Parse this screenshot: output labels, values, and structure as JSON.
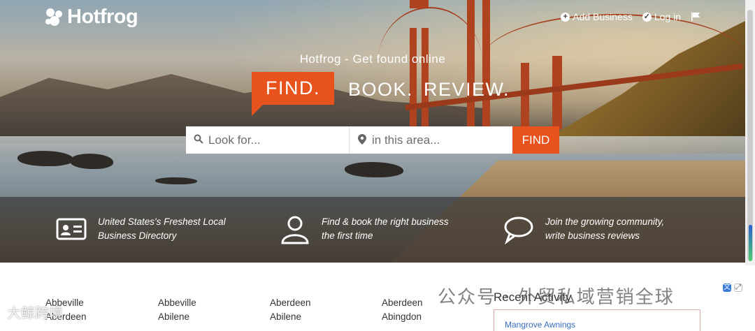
{
  "brand": {
    "name": "Hotfrog"
  },
  "nav": {
    "add_business": "Add Business",
    "login": "Log in"
  },
  "hero": {
    "tagline": "Hotfrog - Get found online",
    "headline_find": "FIND.",
    "headline_rest": "BOOK. REVIEW."
  },
  "search": {
    "what_placeholder": "Look for...",
    "where_placeholder": "in this area...",
    "button": "FIND"
  },
  "features": [
    {
      "icon": "id-card-icon",
      "text": "United States's Freshest Local Business Directory"
    },
    {
      "icon": "user-icon",
      "text": "Find & book the right business the first time"
    },
    {
      "icon": "chat-bubble-icon",
      "text": "Join the growing community, write business reviews"
    }
  ],
  "directory": {
    "columns": [
      [
        "Abbeville",
        "Aberdeen"
      ],
      [
        "Abbeville",
        "Abilene"
      ],
      [
        "Aberdeen",
        "Abilene"
      ],
      [
        "Aberdeen",
        "Abingdon"
      ]
    ]
  },
  "recent": {
    "title": "Recent Activity",
    "first_item": "Mangrove Awnings"
  },
  "watermark": {
    "text": "公众号 · 外贸私域营销全球",
    "corner": "大鲸跨境"
  },
  "colors": {
    "accent": "#e8531d"
  }
}
